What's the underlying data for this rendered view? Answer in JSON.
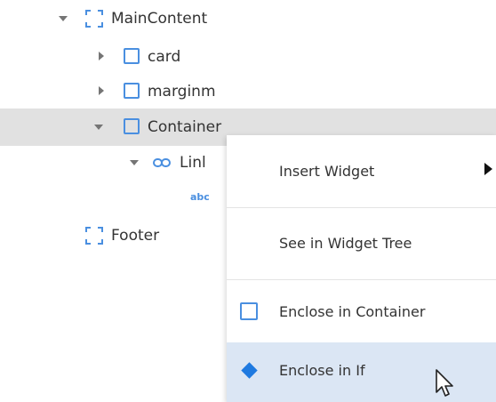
{
  "tree": {
    "items": [
      {
        "label": "MainContent"
      },
      {
        "label": "card"
      },
      {
        "label": "marginm"
      },
      {
        "label": "Container"
      },
      {
        "label": "Linl"
      },
      {
        "label": "Footer"
      }
    ],
    "text_badge": "abc"
  },
  "context_menu": {
    "items": [
      {
        "label": "Insert Widget"
      },
      {
        "label": "See in Widget Tree"
      },
      {
        "label": "Enclose in Container"
      },
      {
        "label": "Enclose in If"
      }
    ]
  },
  "colors": {
    "accent": "#4a8fe0",
    "selected_row": "#e1e1e1",
    "menu_highlight": "#dbe6f4",
    "diamond": "#1f7ae0"
  }
}
